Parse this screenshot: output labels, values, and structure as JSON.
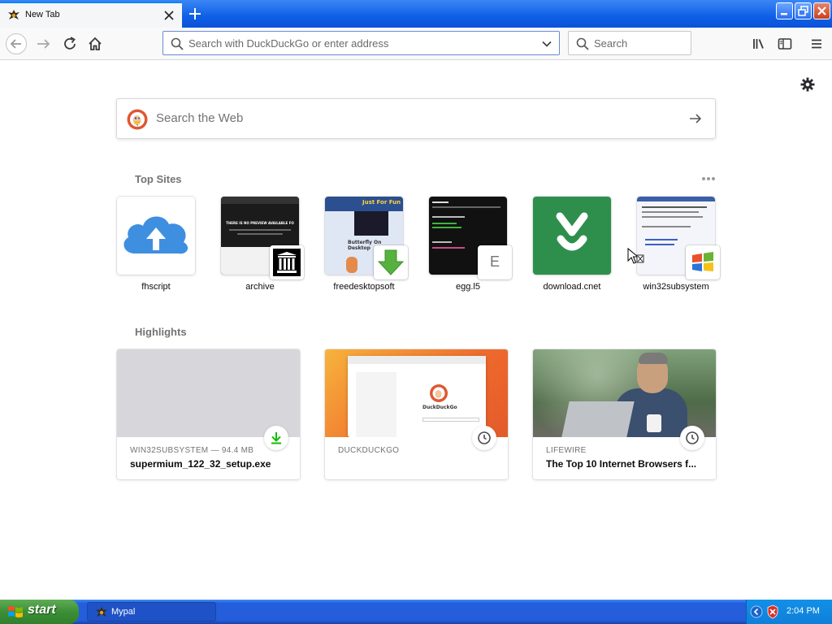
{
  "window": {
    "tab_title": "New Tab"
  },
  "navbar": {
    "url_placeholder": "Search with DuckDuckGo or enter address",
    "search_placeholder": "Search"
  },
  "newtab": {
    "web_search_placeholder": "Search the Web",
    "top_sites_title": "Top Sites",
    "highlights_title": "Highlights",
    "top_sites": [
      {
        "label": "fhscript"
      },
      {
        "label": "archive"
      },
      {
        "label": "freedesktopsoft"
      },
      {
        "label": "egg.l5",
        "icon_letter": "E"
      },
      {
        "label": "download.cnet"
      },
      {
        "label": "win32subsystem"
      }
    ],
    "highlights": [
      {
        "source": "WIN32SUBSYSTEM — 94.4 MB",
        "title": "supermium_122_32_setup.exe",
        "badge": "download-icon"
      },
      {
        "source": "DUCKDUCKGO",
        "title": "",
        "badge": "clock-icon"
      },
      {
        "source": "LIFEWIRE",
        "title": "The Top 10 Internet Browsers f...",
        "badge": "clock-icon"
      }
    ],
    "thumb_text": {
      "archive_notice": "THERE IS NO PREVIEW AVAILABLE FO",
      "freedesktop_banner": "Just For Fun",
      "freedesktop_caption": "Butterfly On Desktop",
      "duckduckgo_brand": "DuckDuckGo"
    }
  },
  "taskbar": {
    "start_label": "start",
    "task_label": "Mypal",
    "clock": "2:04 PM"
  },
  "colors": {
    "accent": "#0a84ff",
    "xp_blue": "#245edb",
    "start_green": "#3c8f36",
    "cnet_green": "#2e8f4c",
    "cloud_blue": "#3e8fe0"
  }
}
